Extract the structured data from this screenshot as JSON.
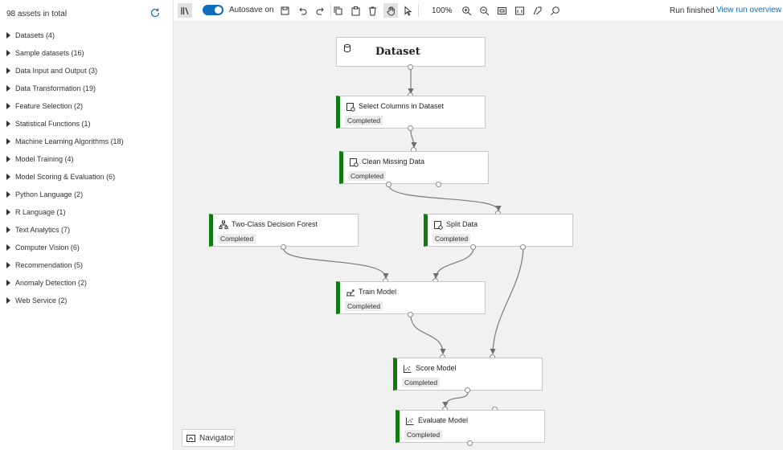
{
  "sidebar": {
    "asset_count": "98 assets in total",
    "categories": [
      {
        "label": "Datasets (4)"
      },
      {
        "label": "Sample datasets (16)"
      },
      {
        "label": "Data Input and Output (3)"
      },
      {
        "label": "Data Transformation (19)"
      },
      {
        "label": "Feature Selection (2)"
      },
      {
        "label": "Statistical Functions (1)"
      },
      {
        "label": "Machine Learning Algorithms (18)"
      },
      {
        "label": "Model Training (4)"
      },
      {
        "label": "Model Scoring & Evaluation (6)"
      },
      {
        "label": "Python Language (2)"
      },
      {
        "label": "R Language (1)"
      },
      {
        "label": "Text Analytics (7)"
      },
      {
        "label": "Computer Vision (6)"
      },
      {
        "label": "Recommendation (5)"
      },
      {
        "label": "Anomaly Detection (2)"
      },
      {
        "label": "Web Service (2)"
      }
    ]
  },
  "toolbar": {
    "autosave_label": "Autosave on",
    "autosave_on": true,
    "zoom_label": "100%",
    "run_status": "Run finished",
    "run_link": "View run overview"
  },
  "nodes": {
    "dataset": {
      "title": "Dataset"
    },
    "select_columns": {
      "title": "Select Columns in Dataset",
      "status": "Completed"
    },
    "clean_missing": {
      "title": "Clean Missing Data",
      "status": "Completed"
    },
    "decision_forest": {
      "title": "Two-Class Decision Forest",
      "status": "Completed"
    },
    "split_data": {
      "title": "Split Data",
      "status": "Completed"
    },
    "train_model": {
      "title": "Train Model",
      "status": "Completed"
    },
    "score_model": {
      "title": "Score Model",
      "status": "Completed"
    },
    "evaluate_model": {
      "title": "Evaluate Model",
      "status": "Completed"
    }
  },
  "navigator": {
    "label": "Navigator"
  },
  "colors": {
    "accent": "#0f6cbd",
    "completed": "#107c10",
    "canvas": "#f1f1f1"
  }
}
